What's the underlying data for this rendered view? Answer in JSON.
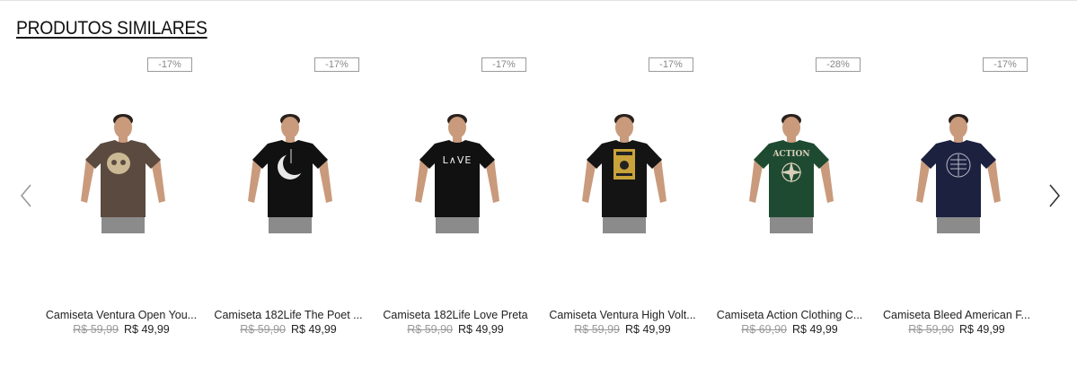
{
  "section": {
    "title": "PRODUTOS SIMILARES"
  },
  "nav": {
    "prev_icon": "chevron-left-icon",
    "next_icon": "chevron-right-icon"
  },
  "products": [
    {
      "name": "Camiseta Ventura Open You...",
      "discount": "-17%",
      "old_price": "R$ 59,99",
      "price": "R$ 49,99",
      "shirt_color": "#5b4a40",
      "print": "skull"
    },
    {
      "name": "Camiseta 182Life The Poet ...",
      "discount": "-17%",
      "old_price": "R$ 59,90",
      "price": "R$ 49,99",
      "shirt_color": "#111111",
      "print": "moon"
    },
    {
      "name": "Camiseta 182Life Love Preta",
      "discount": "-17%",
      "old_price": "R$ 59,90",
      "price": "R$ 49,99",
      "shirt_color": "#111111",
      "print": "love"
    },
    {
      "name": "Camiseta Ventura High Volt...",
      "discount": "-17%",
      "old_price": "R$ 59,99",
      "price": "R$ 49,99",
      "shirt_color": "#141414",
      "print": "poster"
    },
    {
      "name": "Camiseta Action Clothing C...",
      "discount": "-28%",
      "old_price": "R$ 69,90",
      "price": "R$ 49,99",
      "shirt_color": "#1f4a32",
      "print": "compass"
    },
    {
      "name": "Camiseta Bleed American F...",
      "discount": "-17%",
      "old_price": "R$ 59,90",
      "price": "R$ 49,99",
      "shirt_color": "#1c2140",
      "print": "flag"
    }
  ]
}
